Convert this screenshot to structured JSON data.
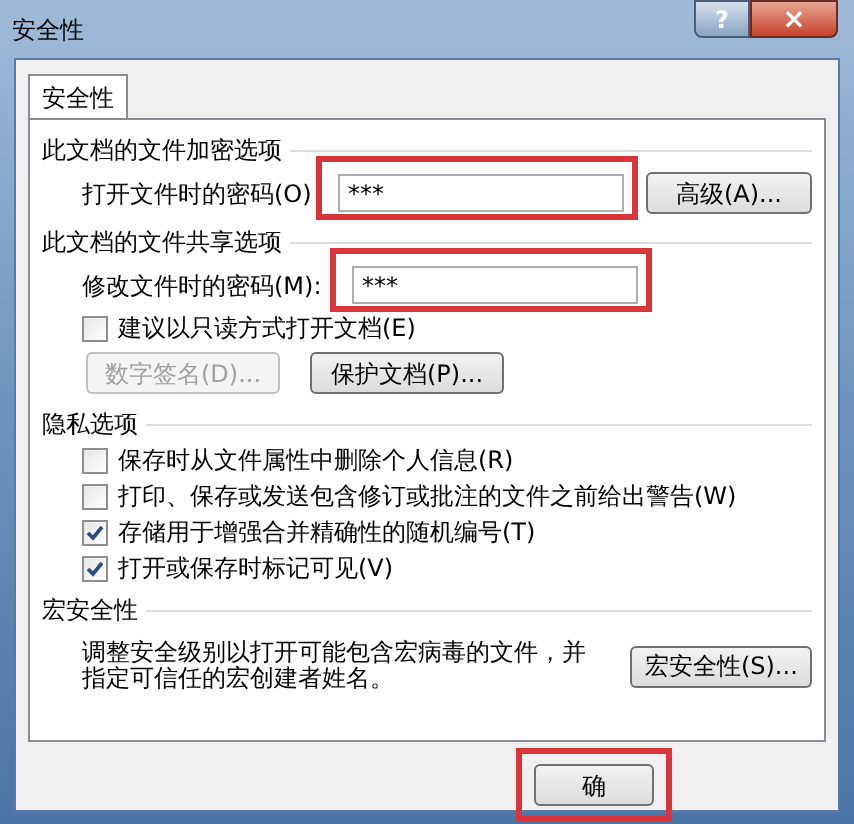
{
  "window": {
    "title": "安全性",
    "buttons": [
      {
        "kind": "help",
        "label": "?"
      },
      {
        "kind": "close",
        "label": "×"
      }
    ]
  },
  "tabs": [
    {
      "label": "安全性",
      "selected": true
    }
  ],
  "sections": [
    {
      "title": "此文档的文件加密选项",
      "items": [
        {
          "kind": "password",
          "label": "打开文件时的密码(O)",
          "value": "***",
          "highlighted": true,
          "button": "高级(A)..."
        }
      ]
    },
    {
      "title": "此文档的文件共享选项",
      "items": [
        {
          "kind": "password",
          "label": "修改文件时的密码(M):",
          "value": "***",
          "highlighted": true
        },
        {
          "kind": "checkbox",
          "label": "建议以只读方式打开文档(E)",
          "checked": false
        },
        {
          "kind": "buttons",
          "buttons": [
            {
              "label": "数字签名(D)...",
              "disabled": true
            },
            {
              "label": "保护文档(P)...",
              "disabled": false
            }
          ]
        }
      ]
    },
    {
      "title": "隐私选项",
      "items": [
        {
          "kind": "checkbox",
          "label": "保存时从文件属性中删除个人信息(R)",
          "checked": false
        },
        {
          "kind": "checkbox",
          "label": "打印、保存或发送包含修订或批注的文件之前给出警告(W)",
          "checked": false
        },
        {
          "kind": "checkbox",
          "label": "存储用于增强合并精确性的随机编号(T)",
          "checked": true
        },
        {
          "kind": "checkbox",
          "label": "打开或保存时标记可见(V)",
          "checked": true
        }
      ]
    },
    {
      "title": "宏安全性",
      "items": [
        {
          "kind": "text_button",
          "text": "调整安全级别以打开可能包含宏病毒的文件，并指定可信任的宏创建者姓名。",
          "button": "宏安全性(S)..."
        }
      ]
    }
  ],
  "footer_buttons": [
    {
      "label": "确",
      "highlighted": true
    }
  ]
}
